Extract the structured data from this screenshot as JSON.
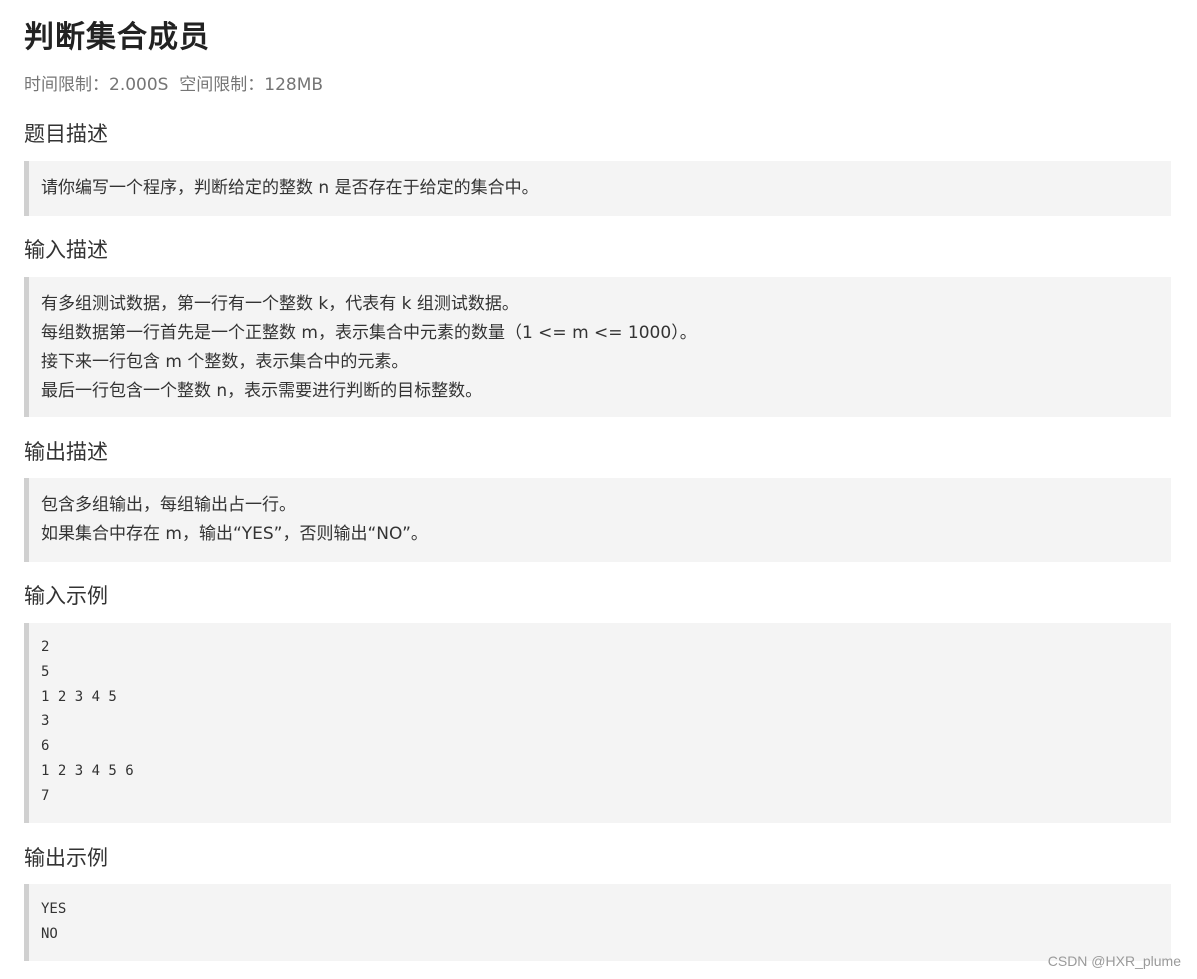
{
  "problem": {
    "title": "判断集合成员",
    "limits": "时间限制：2.000S  空间限制：128MB"
  },
  "sections": {
    "description": {
      "heading": "题目描述",
      "lines": [
        "请你编写一个程序，判断给定的整数 n 是否存在于给定的集合中。"
      ]
    },
    "input": {
      "heading": "输入描述",
      "lines": [
        "有多组测试数据，第一行有一个整数 k，代表有 k 组测试数据。",
        "每组数据第一行首先是一个正整数 m，表示集合中元素的数量（1 <= m <= 1000）。",
        "接下来一行包含 m 个整数，表示集合中的元素。",
        "最后一行包含一个整数 n，表示需要进行判断的目标整数。"
      ]
    },
    "output": {
      "heading": "输出描述",
      "lines": [
        "包含多组输出，每组输出占一行。",
        "如果集合中存在 m，输出“YES”，否则输出“NO”。"
      ]
    },
    "sample_input": {
      "heading": "输入示例",
      "lines": [
        "2",
        "5",
        "1 2 3 4 5",
        "3",
        "6",
        "1 2 3 4 5 6",
        "7"
      ]
    },
    "sample_output": {
      "heading": "输出示例",
      "lines": [
        "YES",
        "NO"
      ]
    }
  },
  "watermark": "CSDN @HXR_plume"
}
